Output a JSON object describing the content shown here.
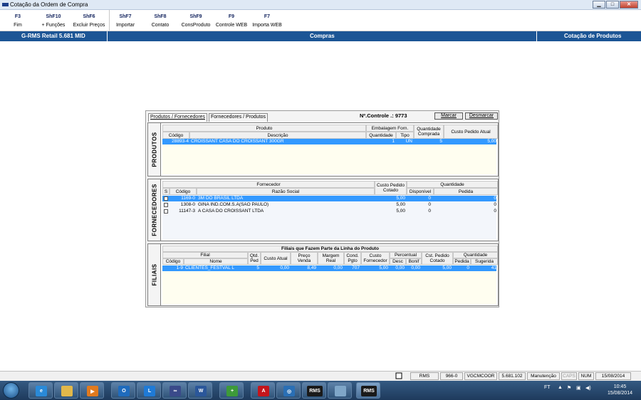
{
  "window": {
    "title": "Cotação da Ordem de Compra"
  },
  "toolbar": [
    {
      "key": "F3",
      "label": "Fim"
    },
    {
      "key": "ShF10",
      "label": "+ Funções"
    },
    {
      "key": "ShF6",
      "label": "Excluir Preços"
    },
    {
      "key": "ShF7",
      "label": "Importar"
    },
    {
      "key": "ShF8",
      "label": "Contato"
    },
    {
      "key": "ShF9",
      "label": "ConsProduto"
    },
    {
      "key": "F9",
      "label": "Controle WEB"
    },
    {
      "key": "F7",
      "label": "Importa WEB"
    }
  ],
  "header": {
    "left": "G-RMS Retail 5.681 MID",
    "center": "Compras",
    "right": "Cotação de Produtos"
  },
  "tabs": [
    "Produtos / Fornecedores",
    "Fornecedores / Produtos"
  ],
  "controle": "Nº.Controle .: 9773",
  "buttons": {
    "marcar": "Marcar",
    "desmarcar": "Desmarcar"
  },
  "produtos": {
    "label": "PRODUTOS",
    "group_produto": "Produto",
    "group_embalagem": "Embalagem Forn.",
    "headers": [
      "Código",
      "Descrição",
      "Quantidade",
      "Tipo",
      "Quantidade Comprada",
      "Custo Pedido Atual"
    ],
    "rows": [
      {
        "codigo": "28893-4",
        "descricao": "CROISSANT CASA DO CROISSANT 300GR",
        "quantidade": "1",
        "tipo": "UN",
        "comprada": "5",
        "custo": "5,00"
      }
    ]
  },
  "fornecedores": {
    "label": "FORNECEDORES",
    "group_fornecedor": "Fornecedor",
    "group_custo": "Custo Pedido Cotado",
    "group_quantidade": "Quantidade",
    "headers": [
      "S",
      "Código",
      "Razão Social",
      "Disponível",
      "Pedida"
    ],
    "rows": [
      {
        "codigo": "1169-0",
        "razao": "3M DO BRASIL LTDA",
        "custo": "5,00",
        "disponivel": "0",
        "pedida": "0",
        "selected": true
      },
      {
        "codigo": "1308-0",
        "razao": "GINA IND.COM.S.A(SAO PAULO)",
        "custo": "5,00",
        "disponivel": "0",
        "pedida": "0",
        "selected": false
      },
      {
        "codigo": "11147-3",
        "razao": "A CASA DO CROISSANT LTDA",
        "custo": "5,00",
        "disponivel": "0",
        "pedida": "0",
        "selected": false
      }
    ]
  },
  "filiais": {
    "label": "FILIAIS",
    "title": "Filiais que Fazem Parte da Linha do Produto",
    "group_filial": "Filial",
    "group_percentual": "Percentual",
    "group_quantidade": "Quantidade",
    "headers": [
      "Código",
      "Nome",
      "Qtd. Ped",
      "Custo Atual",
      "Preço Venda",
      "Margem Real",
      "Cond. Pgto",
      "Custo Fornecedor",
      "Desc",
      "Bonif",
      "Cst. Pedido Cotado",
      "Pedida",
      "Sugerida"
    ],
    "rows": [
      {
        "codigo": "1-9",
        "nome": "CLIENTES_FESTVAL L",
        "qtd": "5",
        "custo_atual": "0,00",
        "preco": "8,49",
        "margem": "0,00",
        "cond": "707",
        "custo_forn": "5,00",
        "desc": "0,00",
        "bonif": "0,00",
        "cst_cotado": "5,00",
        "pedida": "0",
        "sugerida": "41"
      }
    ]
  },
  "statusbar": [
    "RMS",
    "966-0",
    "VGCMCOOR",
    "5.681.102",
    "Manutenção",
    "CAPS",
    "NUM",
    "15/08/2014"
  ],
  "taskbar": {
    "tray_label": "FT",
    "time": "10:45",
    "date": "15/08/2014"
  },
  "colors": {
    "header_blue": "#1c5595",
    "selection": "#3399ff",
    "grid_bg": "#fffef0"
  }
}
